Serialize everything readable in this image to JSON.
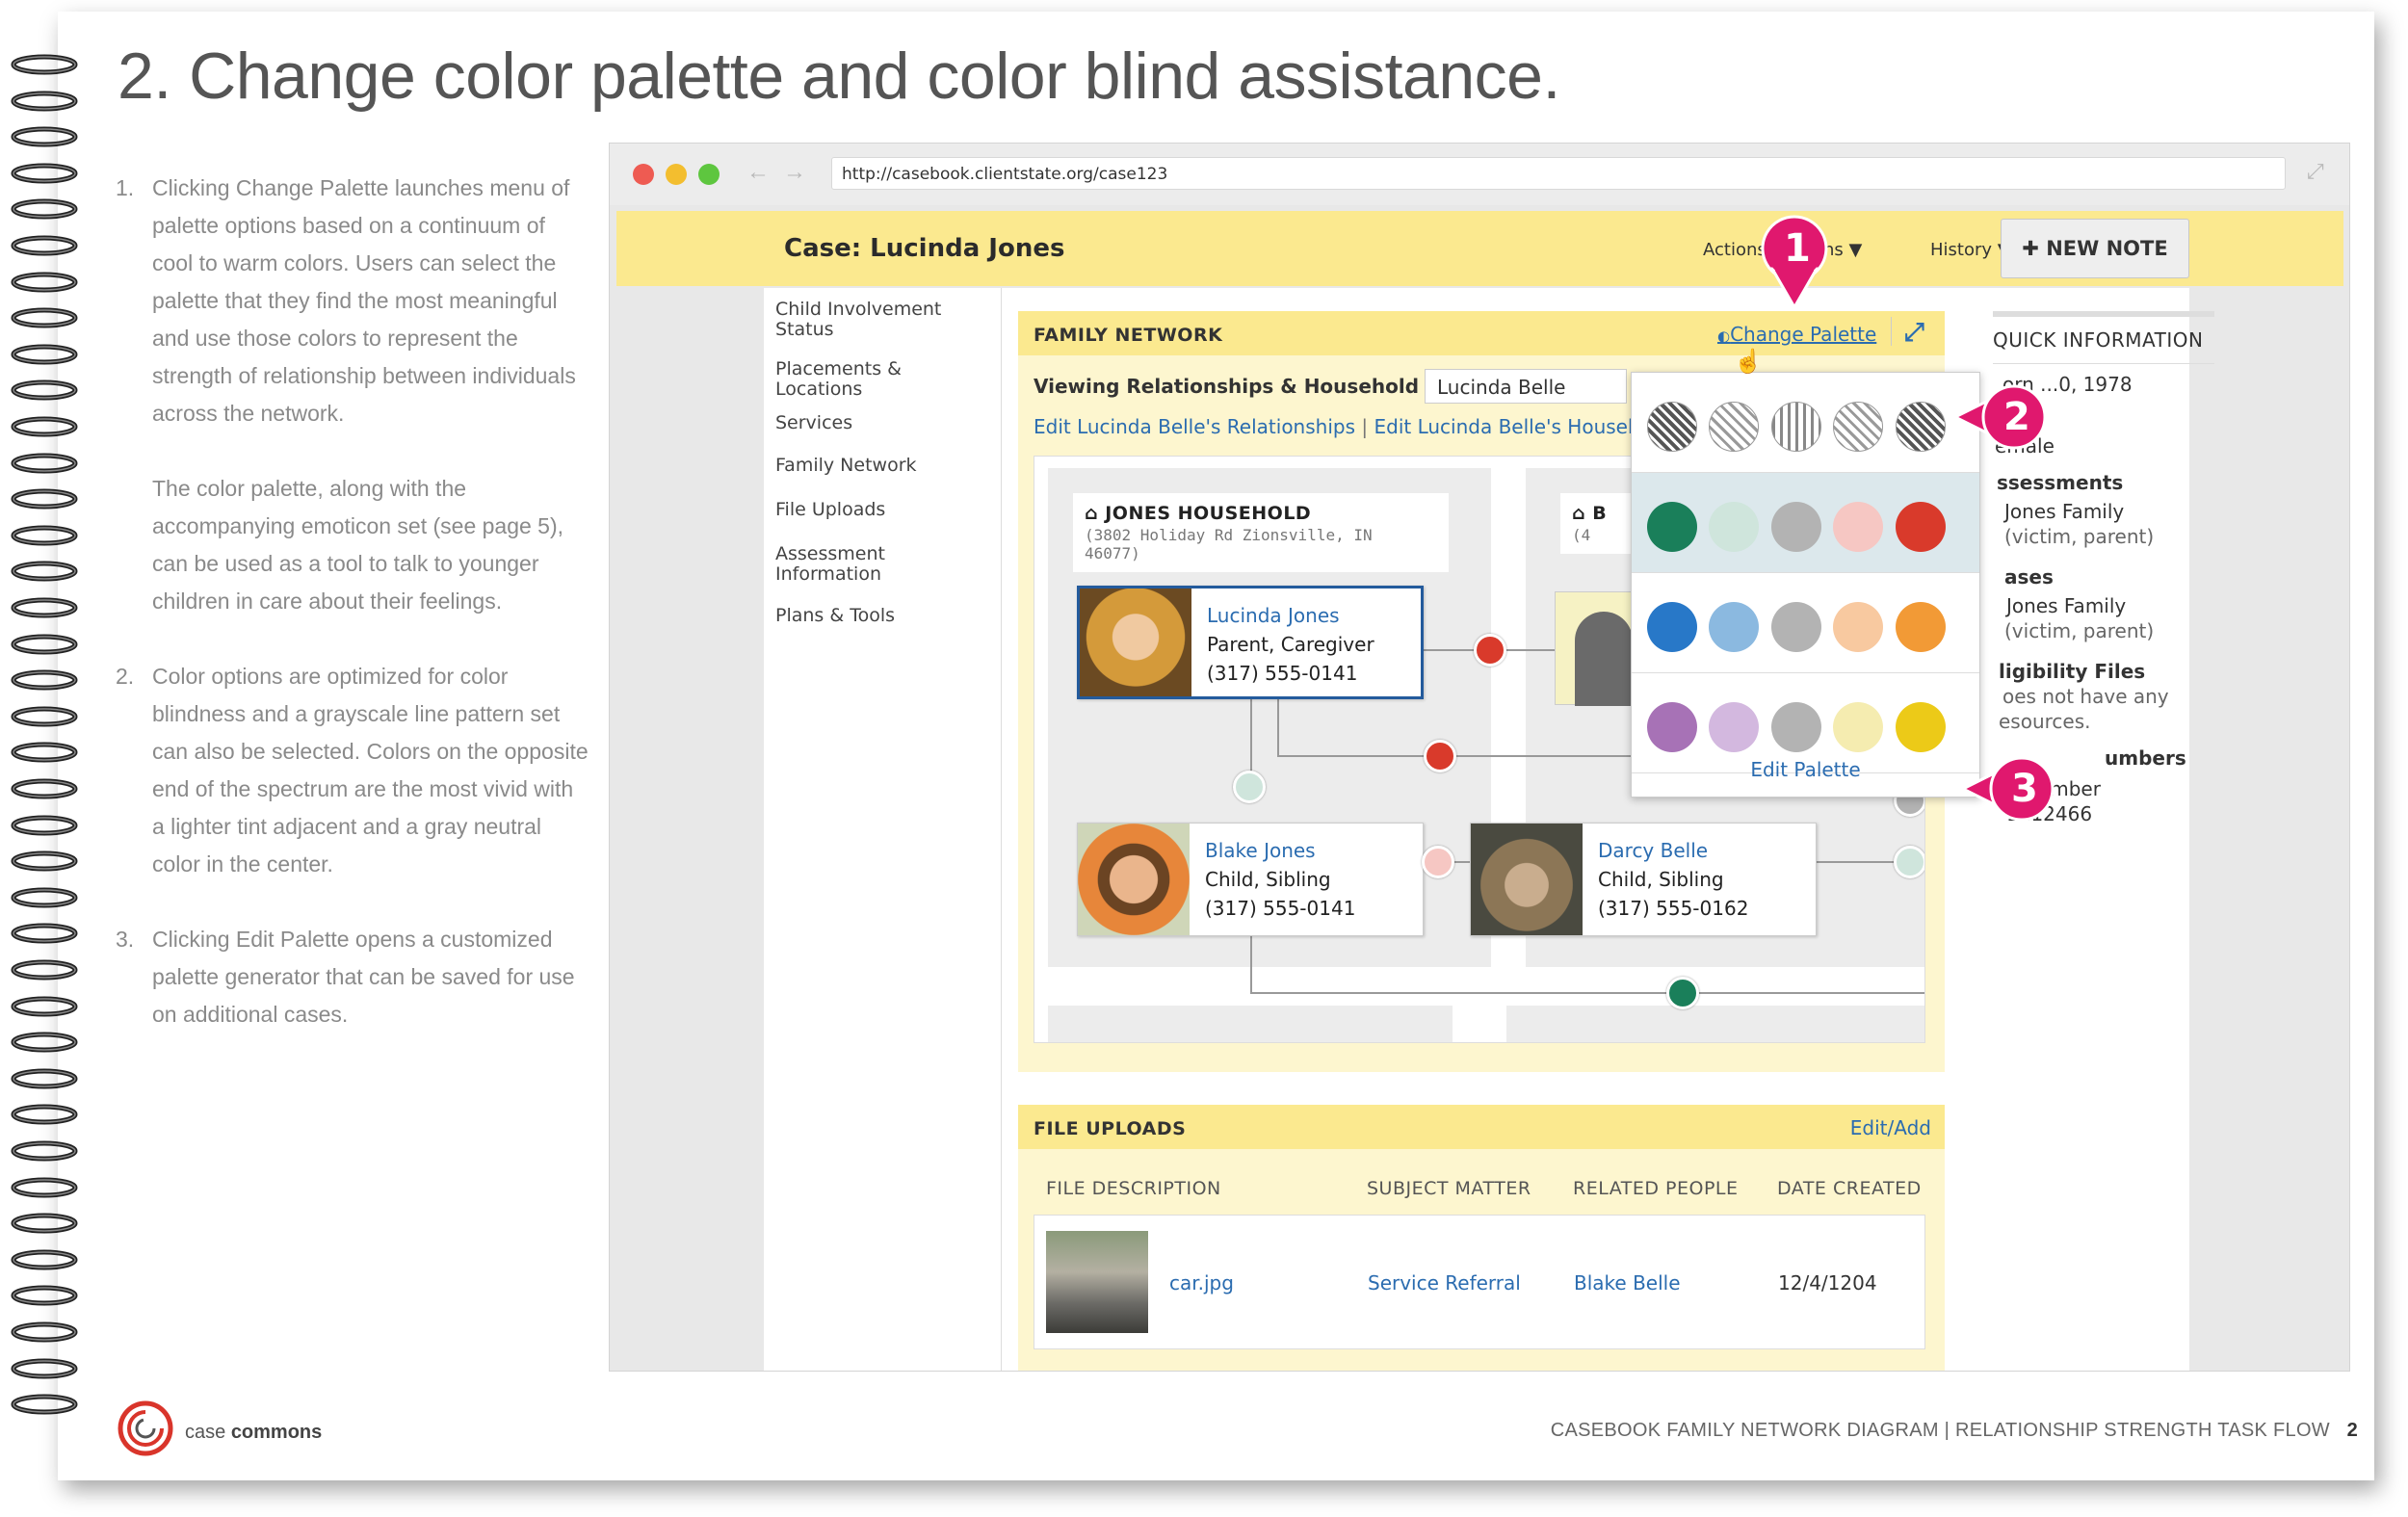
{
  "page_title": "2. Change color palette and color blind assistance.",
  "instructions": [
    {
      "num": "1.",
      "text": "Clicking Change Palette launches menu of palette options based on a continuum of cool to warm colors. Users can select the palette that they find the most meaningful and use those colors to represent the strength of relationship between individuals across the network."
    },
    {
      "num": "",
      "text": "The color palette, along with the accompanying emoticon set (see page 5), can be used as a tool to talk to younger children in care about their feelings."
    },
    {
      "num": "2.",
      "text": "Color options are optimized for color blindness and a grayscale line pattern set can also be selected. Colors on the opposite end of the spectrum are the most vivid with a lighter tint adjacent and a gray neutral color in the center."
    },
    {
      "num": "3.",
      "text": "Clicking Edit Palette opens a customized palette generator that can be saved for use on additional cases."
    }
  ],
  "browser": {
    "url": "http://casebook.clientstate.org/case123",
    "case_title": "Case: Lucinda Jones",
    "menu": {
      "actions": "Actions",
      "actions_tail": "ns",
      "history": "History"
    },
    "new_note": "NEW NOTE"
  },
  "sidenav": [
    "Child Involvement Status",
    "Placements & Locations",
    "Services",
    "Family Network",
    "File Uploads",
    "Assessment Information",
    "Plans & Tools"
  ],
  "family_network": {
    "title": "FAMILY NETWORK",
    "change_palette": "Change Palette",
    "viewing_label": "Viewing Relationships & Household for",
    "selected_person": "Lucinda Belle",
    "edit_relationships": "Edit Lucinda Belle's Relationships",
    "separator": "|",
    "edit_households": "Edit Lucinda Belle's Households",
    "households": [
      {
        "name": "JONES HOUSEHOLD",
        "address": "(3802 Holiday Rd Zionsville, IN 46077)"
      },
      {
        "name": "B",
        "address": "(4"
      }
    ],
    "people": [
      {
        "name": "Lucinda Jones",
        "role": "Parent, Caregiver",
        "phone": "(317) 555-0141"
      },
      {
        "name": "Blake Jones",
        "role": "Child, Sibling",
        "phone": "(317) 555-0141"
      },
      {
        "name": "Darcy Belle",
        "role": "Child, Sibling",
        "phone": "(317) 555-0162"
      }
    ]
  },
  "palette_menu": {
    "rows": [
      {
        "type": "patterns",
        "swatches": [
          "dense-diagonal",
          "diagonal",
          "vertical",
          "diagonal",
          "dense-diagonal"
        ]
      },
      {
        "type": "colors",
        "swatches": [
          "#1a7f5a",
          "#cfe5dc",
          "#b3b3b3",
          "#f6c7c3",
          "#d93a2b"
        ]
      },
      {
        "type": "colors",
        "swatches": [
          "#2878c8",
          "#8bb9e0",
          "#b3b3b3",
          "#f8c9a0",
          "#f29a36"
        ]
      },
      {
        "type": "colors",
        "swatches": [
          "#a772b6",
          "#d3b8df",
          "#b3b3b3",
          "#f5ecb0",
          "#ecca18"
        ]
      }
    ],
    "edit_palette": "Edit Palette"
  },
  "quick_info": {
    "title": "QUICK INFORMATION",
    "lines": [
      {
        "text": "orn ...0, 1978",
        "kind": "text"
      },
      {
        "text": "d)",
        "kind": "text"
      },
      {
        "text": "emale",
        "kind": "text"
      },
      {
        "text": "ssessments",
        "kind": "bold"
      },
      {
        "text": "Jones Family",
        "kind": "link"
      },
      {
        "text": "(victim, parent)",
        "kind": "muted"
      },
      {
        "text": "ases",
        "kind": "bold"
      },
      {
        "text": "Jones Family",
        "kind": "link"
      },
      {
        "text": "(victim, parent)",
        "kind": "muted"
      },
      {
        "text": "ligibility Files",
        "kind": "bold"
      },
      {
        "text": "oes not have any",
        "kind": "muted"
      },
      {
        "text": "esources.",
        "kind": "muted"
      },
      {
        "text": "umbers",
        "kind": "bold"
      },
      {
        "text": "Ca   umber",
        "kind": "text"
      },
      {
        "text": "1212466",
        "kind": "text"
      }
    ]
  },
  "file_uploads": {
    "title": "FILE UPLOADS",
    "edit_add": "Edit/Add",
    "columns": [
      "FILE DESCRIPTION",
      "SUBJECT MATTER",
      "RELATED PEOPLE",
      "DATE CREATED"
    ],
    "rows": [
      {
        "file": "car.jpg",
        "subject": "Service Referral",
        "people": "Blake Belle",
        "date": "12/4/1204"
      }
    ]
  },
  "callouts": [
    "1",
    "2",
    "3"
  ],
  "footer": {
    "logo_text_a": "case",
    "logo_text_b": "commons",
    "right": "CASEBOOK FAMILY NETWORK DIAGRAM | RELATIONSHIP STRENGTH TASK FLOW",
    "page_number": "2"
  },
  "colors": {
    "accent_yellow": "#fbe98f",
    "link_blue": "#2b6cb0",
    "callout_pink": "#e0186e",
    "logo_red": "#d9352b"
  }
}
